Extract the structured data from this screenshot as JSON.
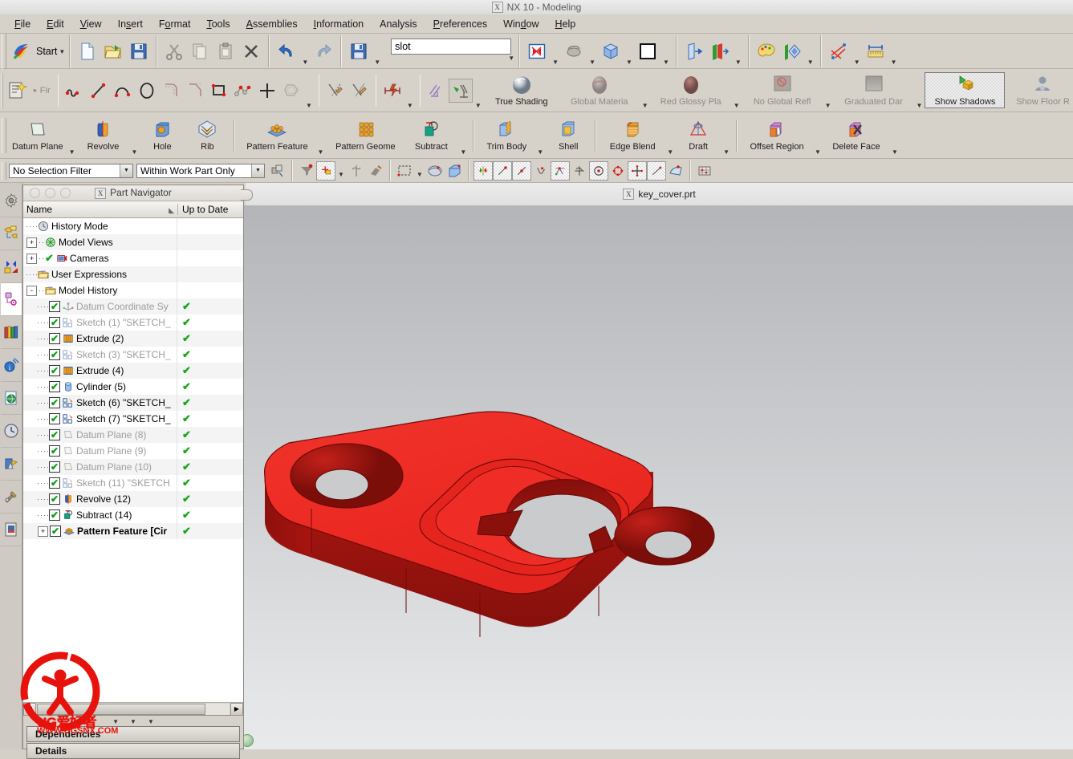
{
  "window": {
    "title": "NX 10 - Modeling",
    "app_badge": "X",
    "part_filename": "key_cover.prt"
  },
  "menubar": {
    "items": [
      {
        "label": "File",
        "accel": "F"
      },
      {
        "label": "Edit",
        "accel": "E"
      },
      {
        "label": "View",
        "accel": "V"
      },
      {
        "label": "Insert",
        "accel": "s"
      },
      {
        "label": "Format",
        "accel": "o"
      },
      {
        "label": "Tools",
        "accel": "T"
      },
      {
        "label": "Assemblies",
        "accel": "A"
      },
      {
        "label": "Information",
        "accel": "I"
      },
      {
        "label": "Analysis",
        "accel": ""
      },
      {
        "label": "Preferences",
        "accel": "P"
      },
      {
        "label": "Window",
        "accel": "W"
      },
      {
        "label": "Help",
        "accel": "H"
      }
    ]
  },
  "standard_toolbar": {
    "start_label": "Start",
    "command_field": {
      "value": "slot",
      "placeholder": ""
    },
    "buttons": [
      {
        "name": "start-menu",
        "label": "Start",
        "icon": "nx-start-icon"
      },
      {
        "name": "new-file",
        "label": "New",
        "icon": "new-document-icon"
      },
      {
        "name": "open-file",
        "label": "Open",
        "icon": "open-folder-icon"
      },
      {
        "name": "save",
        "label": "Save",
        "icon": "floppy-save-icon"
      },
      {
        "name": "cut",
        "label": "Cut",
        "icon": "scissors-icon"
      },
      {
        "name": "copy",
        "label": "Copy",
        "icon": "copy-pages-icon"
      },
      {
        "name": "paste",
        "label": "Paste",
        "icon": "clipboard-icon"
      },
      {
        "name": "delete",
        "label": "Delete",
        "icon": "x-delete-icon"
      },
      {
        "name": "undo",
        "label": "Undo",
        "icon": "undo-arrow-icon"
      },
      {
        "name": "redo",
        "label": "Redo",
        "icon": "redo-arrow-icon"
      },
      {
        "name": "save-as",
        "label": "Save As",
        "icon": "floppy-save-icon"
      },
      {
        "name": "fit-view",
        "label": "Fit",
        "icon": "fit-window-icon"
      },
      {
        "name": "rotate-view",
        "label": "Rotate",
        "icon": "rotate-view-icon"
      },
      {
        "name": "orient-view",
        "label": "Orient",
        "icon": "blue-cube-icon"
      },
      {
        "name": "view-style",
        "label": "Style",
        "icon": "white-square-icon"
      },
      {
        "name": "show-hide",
        "label": "Show",
        "icon": "show-object-icon"
      },
      {
        "name": "show-hide-2",
        "label": "Show 2",
        "icon": "show-hide-icon"
      },
      {
        "name": "edit-appearance",
        "label": "Appearance",
        "icon": "palette-icon"
      },
      {
        "name": "section",
        "label": "Section",
        "icon": "section-diamond-icon"
      },
      {
        "name": "assembly-constraints",
        "label": "Constraints",
        "icon": "constraint-pins-icon"
      },
      {
        "name": "measure",
        "label": "Measure",
        "icon": "ruler-measure-icon"
      }
    ]
  },
  "sketch_toolbar": {
    "buttons": [
      {
        "name": "sketch-in-task",
        "label": "",
        "icon": "sketch-new-icon"
      },
      {
        "name": "finish-sketch",
        "label": "Finish Sketch",
        "icon": "checkered-flag-icon",
        "disabled": true
      },
      {
        "name": "profile",
        "label": "Profile",
        "icon": "profile-curve-icon"
      },
      {
        "name": "line",
        "label": "Line",
        "icon": "line-icon"
      },
      {
        "name": "arc",
        "label": "Arc",
        "icon": "arc-icon"
      },
      {
        "name": "circle",
        "label": "Circle",
        "icon": "circle-icon"
      },
      {
        "name": "fillet",
        "label": "Fillet",
        "icon": "fillet-icon"
      },
      {
        "name": "chamfer",
        "label": "Chamfer",
        "icon": "chamfer-icon"
      },
      {
        "name": "rectangle",
        "label": "Rectangle",
        "icon": "rectangle-icon"
      },
      {
        "name": "studio-spline",
        "label": "Studio Spline",
        "icon": "spline-icon"
      },
      {
        "name": "point",
        "label": "Point",
        "icon": "plus-point-icon"
      },
      {
        "name": "offset-curve",
        "label": "Offset Curve",
        "icon": "offset-curve-icon"
      },
      {
        "name": "quick-trim",
        "label": "Quick Trim",
        "icon": "quick-trim-icon"
      },
      {
        "name": "quick-extend",
        "label": "Quick Extend",
        "icon": "quick-extend-icon"
      },
      {
        "name": "geometric-constraint",
        "label": "Geometric Constraint",
        "icon": "constraint-bolt-icon"
      },
      {
        "name": "make-symmetric",
        "label": "Make Symmetric",
        "icon": "symmetric-icon"
      },
      {
        "name": "display-constraints",
        "label": "Display Constraints",
        "icon": "display-constraints-icon"
      }
    ]
  },
  "shading_toolbar": {
    "buttons": [
      {
        "name": "true-shading",
        "label": "True Shading",
        "icon": "true-shading-sphere-icon",
        "disabled": false,
        "active": false
      },
      {
        "name": "global-material",
        "label": "Global Materia",
        "icon": "global-material-icon",
        "disabled": true
      },
      {
        "name": "red-glossy-plastic",
        "label": "Red Glossy Pla",
        "icon": "red-glossy-icon",
        "disabled": true
      },
      {
        "name": "no-global-reflection",
        "label": "No Global Refl",
        "icon": "no-reflection-icon",
        "disabled": true
      },
      {
        "name": "graduated-dark",
        "label": "Graduated Dar",
        "icon": "graduated-bg-icon",
        "disabled": true
      },
      {
        "name": "show-shadows",
        "label": "Show Shadows",
        "icon": "show-shadows-icon",
        "disabled": false,
        "active": true
      },
      {
        "name": "show-floor-reflection",
        "label": "Show Floor R",
        "icon": "floor-reflection-icon",
        "disabled": true
      }
    ]
  },
  "feature_toolbar": {
    "buttons": [
      {
        "name": "datum-plane",
        "label": "Datum Plane",
        "icon": "datum-plane-icon",
        "has_dropdown": true
      },
      {
        "name": "revolve",
        "label": "Revolve",
        "icon": "revolve-icon",
        "has_dropdown": true
      },
      {
        "name": "hole",
        "label": "Hole",
        "icon": "hole-icon",
        "has_dropdown": false
      },
      {
        "name": "rib",
        "label": "Rib",
        "icon": "rib-icon",
        "has_dropdown": false
      },
      {
        "name": "pattern-feature",
        "label": "Pattern Feature",
        "icon": "pattern-feature-icon",
        "has_dropdown": true
      },
      {
        "name": "pattern-geometry",
        "label": "Pattern Geome",
        "icon": "pattern-geometry-icon",
        "has_dropdown": false
      },
      {
        "name": "subtract",
        "label": "Subtract",
        "icon": "subtract-icon",
        "has_dropdown": true
      },
      {
        "name": "trim-body",
        "label": "Trim Body",
        "icon": "trim-body-icon",
        "has_dropdown": true
      },
      {
        "name": "shell",
        "label": "Shell",
        "icon": "shell-icon",
        "has_dropdown": false
      },
      {
        "name": "edge-blend",
        "label": "Edge Blend",
        "icon": "edge-blend-icon",
        "has_dropdown": true
      },
      {
        "name": "draft",
        "label": "Draft",
        "icon": "draft-icon",
        "has_dropdown": true
      },
      {
        "name": "offset-region",
        "label": "Offset Region",
        "icon": "offset-region-icon",
        "has_dropdown": true
      },
      {
        "name": "delete-face",
        "label": "Delete Face",
        "icon": "delete-face-icon",
        "has_dropdown": true
      }
    ]
  },
  "selection_bar": {
    "filter_combo": {
      "value": "No Selection Filter"
    },
    "scope_combo": {
      "value": "Within Work Part Only"
    },
    "icons": [
      {
        "name": "select-general-objects-icon"
      },
      {
        "name": "select-feature-icon"
      },
      {
        "name": "snap-point-icon"
      },
      {
        "name": "select-datum-icon"
      },
      {
        "name": "select-component-icon"
      },
      {
        "name": "rectangle-select-icon"
      },
      {
        "name": "face-select-icon"
      },
      {
        "name": "solid-body-select-icon"
      },
      {
        "name": "enable-snap-point-icon"
      },
      {
        "name": "end-point-snap-icon"
      },
      {
        "name": "midpoint-snap-icon"
      },
      {
        "name": "control-point-snap-icon"
      },
      {
        "name": "intersection-snap-icon"
      },
      {
        "name": "arc-center-snap-icon"
      },
      {
        "name": "quadrant-snap-icon"
      },
      {
        "name": "existing-point-snap-icon"
      },
      {
        "name": "point-on-curve-snap-icon"
      },
      {
        "name": "point-on-face-snap-icon"
      },
      {
        "name": "grid-snap-icon"
      }
    ]
  },
  "part_navigator": {
    "title": "Part Navigator",
    "badge": "X",
    "columns": {
      "name": "Name",
      "status": "Up to Date"
    },
    "tree": [
      {
        "label": "History Mode",
        "icon": "clock-icon",
        "level": 1,
        "expander": "",
        "checkbox": false,
        "status": "",
        "gray": false,
        "bold": false
      },
      {
        "label": "Model Views",
        "icon": "model-views-icon",
        "level": 1,
        "expander": "+",
        "checkbox": false,
        "status": "",
        "gray": false,
        "bold": false
      },
      {
        "label": "Cameras",
        "icon": "camera-icon",
        "level": 1,
        "expander": "+",
        "checkbox": false,
        "status": "",
        "gray": false,
        "bold": false,
        "precheck": true
      },
      {
        "label": "User Expressions",
        "icon": "folder-icon",
        "level": 1,
        "expander": "",
        "checkbox": false,
        "status": "",
        "gray": false,
        "bold": false
      },
      {
        "label": "Model History",
        "icon": "folder-icon",
        "level": 1,
        "expander": "-",
        "checkbox": false,
        "status": "",
        "gray": false,
        "bold": false
      },
      {
        "label": "Datum Coordinate Sy",
        "icon": "datum-csys-icon",
        "level": 2,
        "expander": "",
        "checkbox": true,
        "status": "ok",
        "gray": true,
        "bold": false
      },
      {
        "label": "Sketch (1) \"SKETCH_",
        "icon": "sketch-icon",
        "level": 2,
        "expander": "",
        "checkbox": true,
        "status": "ok",
        "gray": true,
        "bold": false
      },
      {
        "label": "Extrude (2)",
        "icon": "extrude-icon",
        "level": 2,
        "expander": "",
        "checkbox": true,
        "status": "ok",
        "gray": false,
        "bold": false
      },
      {
        "label": "Sketch (3) \"SKETCH_",
        "icon": "sketch-icon",
        "level": 2,
        "expander": "",
        "checkbox": true,
        "status": "ok",
        "gray": true,
        "bold": false
      },
      {
        "label": "Extrude (4)",
        "icon": "extrude-icon",
        "level": 2,
        "expander": "",
        "checkbox": true,
        "status": "ok",
        "gray": false,
        "bold": false
      },
      {
        "label": "Cylinder (5)",
        "icon": "cylinder-icon",
        "level": 2,
        "expander": "",
        "checkbox": true,
        "status": "ok",
        "gray": false,
        "bold": false
      },
      {
        "label": "Sketch (6) \"SKETCH_",
        "icon": "sketch-icon",
        "level": 2,
        "expander": "",
        "checkbox": true,
        "status": "ok",
        "gray": false,
        "bold": false
      },
      {
        "label": "Sketch (7) \"SKETCH_",
        "icon": "sketch-icon",
        "level": 2,
        "expander": "",
        "checkbox": true,
        "status": "ok",
        "gray": false,
        "bold": false
      },
      {
        "label": "Datum Plane (8)",
        "icon": "datum-plane-icon",
        "level": 2,
        "expander": "",
        "checkbox": true,
        "status": "ok",
        "gray": true,
        "bold": false
      },
      {
        "label": "Datum Plane (9)",
        "icon": "datum-plane-icon",
        "level": 2,
        "expander": "",
        "checkbox": true,
        "status": "ok",
        "gray": true,
        "bold": false
      },
      {
        "label": "Datum Plane (10)",
        "icon": "datum-plane-icon",
        "level": 2,
        "expander": "",
        "checkbox": true,
        "status": "ok",
        "gray": true,
        "bold": false
      },
      {
        "label": "Sketch (11) \"SKETCH",
        "icon": "sketch-icon",
        "level": 2,
        "expander": "",
        "checkbox": true,
        "status": "ok",
        "gray": true,
        "bold": false
      },
      {
        "label": "Revolve (12)",
        "icon": "revolve-icon",
        "level": 2,
        "expander": "",
        "checkbox": true,
        "status": "ok",
        "gray": false,
        "bold": false
      },
      {
        "label": "Subtract (14)",
        "icon": "subtract-icon",
        "level": 2,
        "expander": "",
        "checkbox": true,
        "status": "ok",
        "gray": false,
        "bold": false
      },
      {
        "label": "Pattern Feature [Cir",
        "icon": "pattern-feature-icon",
        "level": 2,
        "expander": "+",
        "checkbox": true,
        "status": "ok",
        "gray": false,
        "bold": true
      }
    ],
    "bottom_panels": [
      {
        "label": "Dependencies"
      },
      {
        "label": "Details"
      }
    ]
  },
  "resource_bar": {
    "items": [
      {
        "name": "assembly-navigator-icon",
        "label": "Assembly Navigator"
      },
      {
        "name": "constraint-navigator-icon",
        "label": "Constraint Navigator"
      },
      {
        "name": "part-navigator-icon",
        "label": "Part Navigator",
        "selected": true
      },
      {
        "name": "reuse-library-icon",
        "label": "Reuse Library"
      },
      {
        "name": "hd3d-tools-icon",
        "label": "HD3D Tools"
      },
      {
        "name": "web-browser-icon",
        "label": "Internet Explorer"
      },
      {
        "name": "history-icon",
        "label": "History"
      },
      {
        "name": "process-studio-icon",
        "label": "Process Studio"
      },
      {
        "name": "manufacturing-wizards-icon",
        "label": "Manufacturing Wizards"
      },
      {
        "name": "roleadvanced-icon",
        "label": "Roles"
      }
    ]
  },
  "viewport": {
    "model_name": "key_cover",
    "body_color": "#ee2b24",
    "body_shadow_color": "#9e1410",
    "bg_top": "#b3b5b8",
    "bg_bottom": "#e8eaec"
  },
  "watermark": {
    "line1": "UG爱好者",
    "line2": "WWW.UGSNX.COM",
    "color": "#e8120c"
  }
}
